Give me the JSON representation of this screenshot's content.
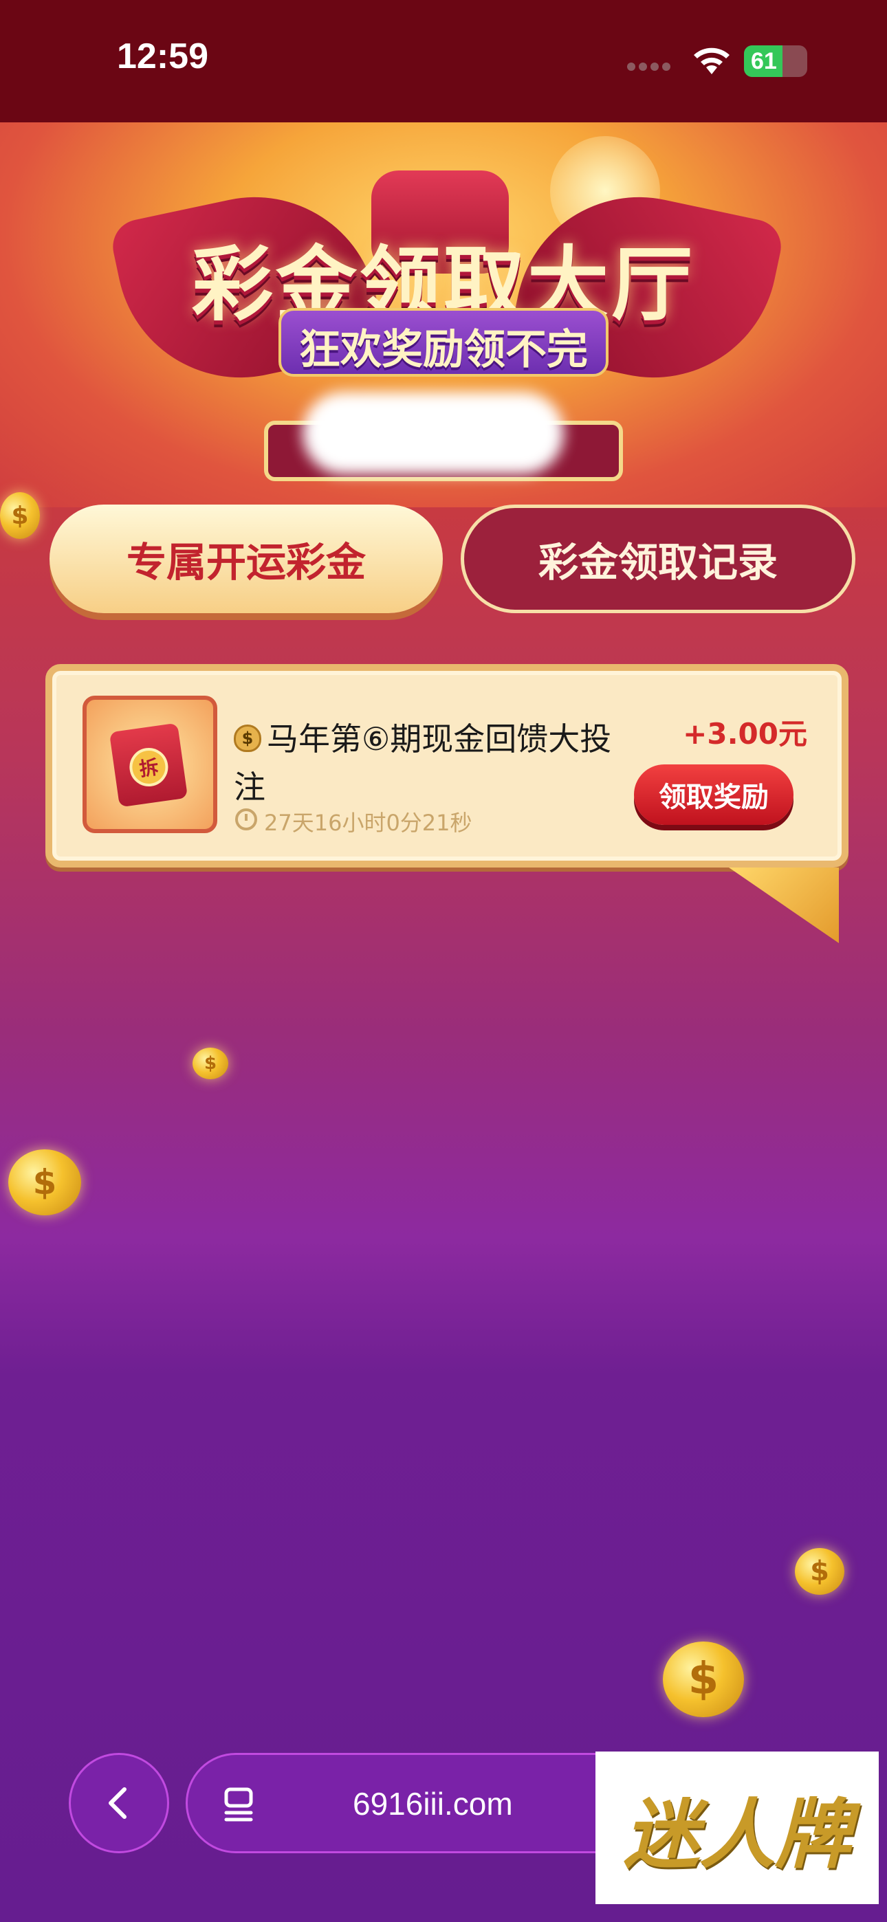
{
  "status_bar": {
    "time": "12:59",
    "battery": "61",
    "battery_level": 0.61
  },
  "banner": {
    "title": "彩金领取大厅",
    "subtitle": "狂欢奖励领不完"
  },
  "tabs": [
    {
      "label": "专属开运彩金",
      "active": true
    },
    {
      "label": "彩金领取记录",
      "active": false
    }
  ],
  "reward_card": {
    "icon_seal": "拆",
    "moneybag_glyph": "$",
    "title": "马年第⑥期现金回馈大投注",
    "countdown": "27天16小时0分21秒",
    "amount": "+3.00元",
    "claim_label": "领取奖励"
  },
  "coin_glyph": "$",
  "browser_bar": {
    "url": "6916iii.com"
  },
  "watermark": "迷人牌",
  "colors": {
    "status_bar_bg": "#6b0614",
    "tab_active_text": "#c2232e",
    "amount": "#d42a2a",
    "claim_button": "#e02a2a",
    "page_purple": "#661d90"
  }
}
